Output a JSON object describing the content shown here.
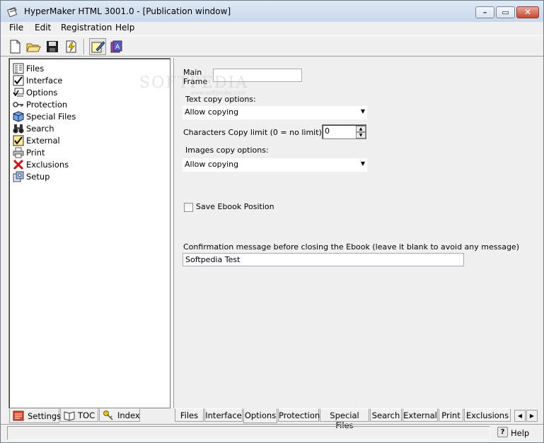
{
  "window": {
    "title": "HyperMaker HTML 3001.0 - [Publication window]"
  },
  "menu": [
    "File",
    "Edit",
    "Registration",
    "Help"
  ],
  "toolbar": {
    "buttons": [
      "new-icon",
      "open-folder-icon",
      "save-icon",
      "build-icon",
      "edit-icon",
      "publish-icon"
    ]
  },
  "sidebar": {
    "items": [
      {
        "label": "Files",
        "icon": "files-icon"
      },
      {
        "label": "Interface",
        "icon": "interface-icon"
      },
      {
        "label": "Options",
        "icon": "options-icon"
      },
      {
        "label": "Protection",
        "icon": "key-icon"
      },
      {
        "label": "Special Files",
        "icon": "cube-icon"
      },
      {
        "label": "Search",
        "icon": "binoculars-icon"
      },
      {
        "label": "External",
        "icon": "checklist-icon"
      },
      {
        "label": "Print",
        "icon": "printer-icon"
      },
      {
        "label": "Exclusions",
        "icon": "red-x-icon"
      },
      {
        "label": "Setup",
        "icon": "setup-icon"
      }
    ],
    "tabs": [
      "Settings",
      "TOC",
      "Index"
    ]
  },
  "options": {
    "main_frame_label_1": "Main",
    "main_frame_label_2": "Frame",
    "main_frame_value": "",
    "text_copy_label": "Text copy options:",
    "text_copy_value": "Allow copying",
    "char_limit_label": "Characters Copy limit (0 = no limit)",
    "char_limit_value": "0",
    "images_copy_label": "Images copy options:",
    "images_copy_value": "Allow copying",
    "save_position_label": "Save Ebook Position",
    "save_position_checked": false,
    "confirm_label": "Confirmation message before closing the Ebook (leave it blank to avoid any message)",
    "confirm_value": "Softpedia Test"
  },
  "watermark": {
    "text": "SOFTPEDIA",
    "sub": "www.softpedia.com"
  },
  "bottom_tabs": [
    "Files",
    "Interface",
    "Options",
    "Protection",
    "Special Files",
    "Search",
    "External",
    "Print",
    "Exclusions"
  ],
  "status": {
    "help_label": "Help"
  }
}
